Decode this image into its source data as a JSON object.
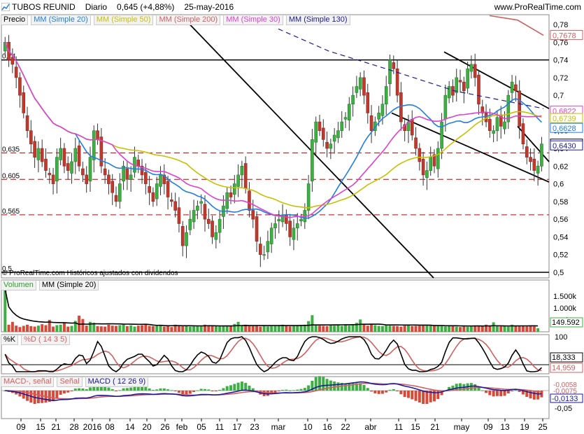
{
  "header": {
    "instrument": "TUBOS REUNID",
    "period": "Diario",
    "last": "0,645 (+4,88%)",
    "date": "25-may-2016",
    "site": "www.ProRealTime.com"
  },
  "price_legend": [
    {
      "label": "Precio",
      "color": "#000000"
    },
    {
      "label": "MM (Simple 20)",
      "color": "#1e7fe0"
    },
    {
      "label": "MM (Simple 50)",
      "color": "#c8c000"
    },
    {
      "label": "MM (Simple 200)",
      "color": "#d06060"
    },
    {
      "label": "MM (Simple 30)",
      "color": "#e040d0"
    },
    {
      "label": "MM (Simple 130)",
      "color": "#1a1a9a"
    }
  ],
  "copyright": "© ProRealTime.com Históricos ajustados con dividendos",
  "volume_legend": [
    {
      "label": "Volumen",
      "color": "#2ca02c"
    },
    {
      "label": "MM (Simple 20)",
      "color": "#000000"
    }
  ],
  "stoch_legend": [
    {
      "label": "%K",
      "color": "#000000"
    },
    {
      "label": "%D ( 14 3 5)",
      "color": "#d06060"
    }
  ],
  "macd_legend": [
    {
      "label": "MACD-, señal",
      "color": "#d06060"
    },
    {
      "label": "Señal",
      "color": "#d06060"
    },
    {
      "label": "MACD ( 12 26 9)",
      "color": "#1a1a9a"
    }
  ],
  "chart_data": {
    "type": "candlestick",
    "x_tick_labels": [
      "09",
      "15",
      "21",
      "28",
      "2016",
      "08",
      "14",
      "20",
      "26",
      "feb",
      "05",
      "11",
      "17",
      "23",
      "mar",
      "10",
      "16",
      "22",
      "abr",
      "11",
      "15",
      "21",
      "may",
      "09",
      "13",
      "19",
      "25"
    ],
    "price_axis": {
      "ylim": [
        0.5,
        0.78
      ],
      "tick_labels": [
        "0,78",
        "0,76",
        "0,74",
        "0,72",
        "0,7",
        "0,68",
        "0,66",
        "0,64",
        "0,62",
        "0,6",
        "0,58",
        "0,56",
        "0,54",
        "0,52",
        "0,5"
      ],
      "tick_values": [
        0.78,
        0.76,
        0.74,
        0.72,
        0.7,
        0.68,
        0.66,
        0.64,
        0.62,
        0.6,
        0.58,
        0.56,
        0.54,
        0.52,
        0.5
      ]
    },
    "horizontal_lines": [
      {
        "value": 0.74,
        "label": "0,74",
        "style": "solid",
        "color": "#000000"
      },
      {
        "value": 0.635,
        "label": "0,635",
        "style": "dashed",
        "color": "#c00000"
      },
      {
        "value": 0.605,
        "label": "0,605",
        "style": "dashed",
        "color": "#c00000"
      },
      {
        "value": 0.565,
        "label": "0,565",
        "style": "dashed",
        "color": "#c00000"
      },
      {
        "value": 0.5,
        "label": "0,5",
        "style": "solid",
        "color": "#000000"
      }
    ],
    "price_tags": [
      {
        "value": 0.7678,
        "label": "0,7678",
        "color": "#d06060"
      },
      {
        "value": 0.6822,
        "label": "0,6822",
        "color": "#e040d0"
      },
      {
        "value": 0.6739,
        "label": "0,6739",
        "color": "#c8c000"
      },
      {
        "value": 0.6628,
        "label": "0,6628",
        "color": "#1e7fe0"
      },
      {
        "value": 0.645,
        "label": "0,645",
        "color": "#000000"
      },
      {
        "value": 0.643,
        "label": "0,6430",
        "color": "#1a1a9a"
      }
    ],
    "closes": [
      0.76,
      0.74,
      0.735,
      0.72,
      0.7,
      0.68,
      0.66,
      0.645,
      0.63,
      0.64,
      0.625,
      0.615,
      0.61,
      0.6,
      0.63,
      0.64,
      0.62,
      0.615,
      0.625,
      0.64,
      0.62,
      0.61,
      0.6,
      0.63,
      0.66,
      0.65,
      0.62,
      0.61,
      0.6,
      0.59,
      0.58,
      0.6,
      0.62,
      0.605,
      0.61,
      0.63,
      0.62,
      0.61,
      0.6,
      0.59,
      0.58,
      0.6,
      0.61,
      0.6,
      0.585,
      0.58,
      0.57,
      0.555,
      0.53,
      0.545,
      0.56,
      0.57,
      0.575,
      0.58,
      0.56,
      0.555,
      0.54,
      0.545,
      0.56,
      0.575,
      0.59,
      0.585,
      0.6,
      0.61,
      0.62,
      0.595,
      0.57,
      0.56,
      0.535,
      0.52,
      0.52,
      0.535,
      0.55,
      0.555,
      0.56,
      0.565,
      0.555,
      0.54,
      0.55,
      0.555,
      0.56,
      0.57,
      0.6,
      0.65,
      0.67,
      0.66,
      0.65,
      0.64,
      0.645,
      0.655,
      0.66,
      0.67,
      0.675,
      0.69,
      0.7,
      0.71,
      0.72,
      0.7,
      0.68,
      0.66,
      0.67,
      0.68,
      0.69,
      0.71,
      0.74,
      0.73,
      0.7,
      0.67,
      0.66,
      0.67,
      0.655,
      0.64,
      0.625,
      0.61,
      0.615,
      0.63,
      0.62,
      0.64,
      0.67,
      0.7,
      0.71,
      0.7,
      0.72,
      0.715,
      0.705,
      0.73,
      0.735,
      0.72,
      0.69,
      0.68,
      0.67,
      0.66,
      0.66,
      0.675,
      0.665,
      0.67,
      0.7,
      0.715,
      0.705,
      0.665,
      0.645,
      0.63,
      0.625,
      0.615,
      0.62,
      0.645
    ],
    "ma_series": [
      {
        "name": "MM (Simple 20)",
        "color": "#1e7fe0"
      },
      {
        "name": "MM (Simple 50)",
        "color": "#c8c000"
      },
      {
        "name": "MM (Simple 200)",
        "color": "#d06060"
      },
      {
        "name": "MM (Simple 30)",
        "color": "#e040d0"
      },
      {
        "name": "MM (Simple 130)",
        "color": "#1a1a9a"
      }
    ],
    "volume_axis": {
      "tick_labels": [
        "1.500k",
        "1.000k",
        "500k"
      ],
      "tick_values": [
        1500,
        1000,
        500
      ],
      "ma_tag": "149.592"
    },
    "volumes": [
      1800,
      300,
      420,
      260,
      200,
      250,
      300,
      240,
      220,
      260,
      320,
      280,
      500,
      220,
      280,
      300,
      380,
      220,
      250,
      460,
      680,
      540,
      260,
      420,
      380,
      240,
      230,
      220,
      300,
      260,
      250,
      280,
      300,
      240,
      270,
      220,
      260,
      280,
      300,
      250,
      240,
      260,
      280,
      220,
      250,
      200,
      300,
      250,
      260,
      240,
      220,
      230,
      240,
      250,
      300,
      280,
      260,
      240,
      250,
      230,
      240,
      250,
      330,
      420,
      260,
      300,
      250,
      240,
      260,
      220,
      250,
      230,
      240,
      260,
      250,
      300,
      280,
      230,
      240,
      250,
      260,
      300,
      450,
      700,
      300,
      260,
      250,
      240,
      300,
      260,
      280,
      250,
      300,
      260,
      280,
      380,
      520,
      300,
      260,
      320,
      280,
      250,
      240,
      300,
      260,
      250,
      240,
      220,
      260,
      280,
      240,
      250,
      260,
      270,
      280,
      300,
      260,
      250,
      240,
      230,
      250,
      240,
      220,
      200,
      230,
      210,
      250,
      240,
      260,
      220,
      300,
      250,
      400,
      260,
      230,
      240,
      220,
      300,
      250,
      240,
      260,
      230,
      260,
      230,
      150
    ],
    "stochastic": {
      "axis_labels": [
        "100",
        "0"
      ],
      "tags": [
        {
          "label": "18,333"
        },
        {
          "label": "14,959"
        }
      ]
    },
    "macd": {
      "axis_labels": [
        "-0,05"
      ],
      "tags": [
        {
          "label": "-0,0058"
        },
        {
          "label": "-0,0075"
        },
        {
          "label": "-0,0133"
        }
      ]
    }
  }
}
